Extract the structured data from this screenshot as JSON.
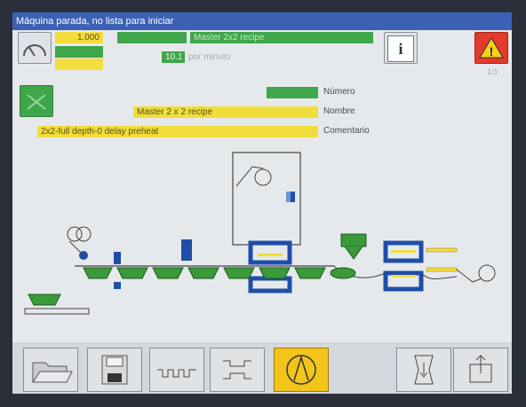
{
  "titlebar": {
    "text": "Máquina parada, no lista para iniciar"
  },
  "header": {
    "counter_value": "1.000",
    "green_value": "",
    "recipe_bar_text": "Master 2x2 recipe",
    "rate_value": "10.1",
    "rate_unit": "por minuto",
    "center_label": "",
    "right_value": "",
    "page_indicator": "1/1"
  },
  "recipe": {
    "number_value": "",
    "number_label": "Número",
    "name_value": "Master 2 x 2 recipe",
    "name_label": "Nombre",
    "comment_value": "2x2-full depth-0 delay preheat",
    "comment_label": "Comentario"
  },
  "colors": {
    "title_bg": "#3c61b4",
    "field_yellow": "#f1dd3b",
    "field_green": "#3fa64a",
    "warning_red": "#e23a2c",
    "active_button": "#f3c51a",
    "machine_blue": "#1f4ea8",
    "tray_green": "#3a9a3a"
  },
  "icons": {
    "gauge": "gauge-icon",
    "info": "info-icon",
    "warning": "warning-icon",
    "roll": "film-roll-icon",
    "folder": "folder-open-icon",
    "save": "save-icon",
    "forming": "forming-station-icon",
    "sealing": "sealing-station-icon",
    "start": "start-cycle-icon",
    "door": "door-indexer-icon",
    "export": "export-icon"
  }
}
